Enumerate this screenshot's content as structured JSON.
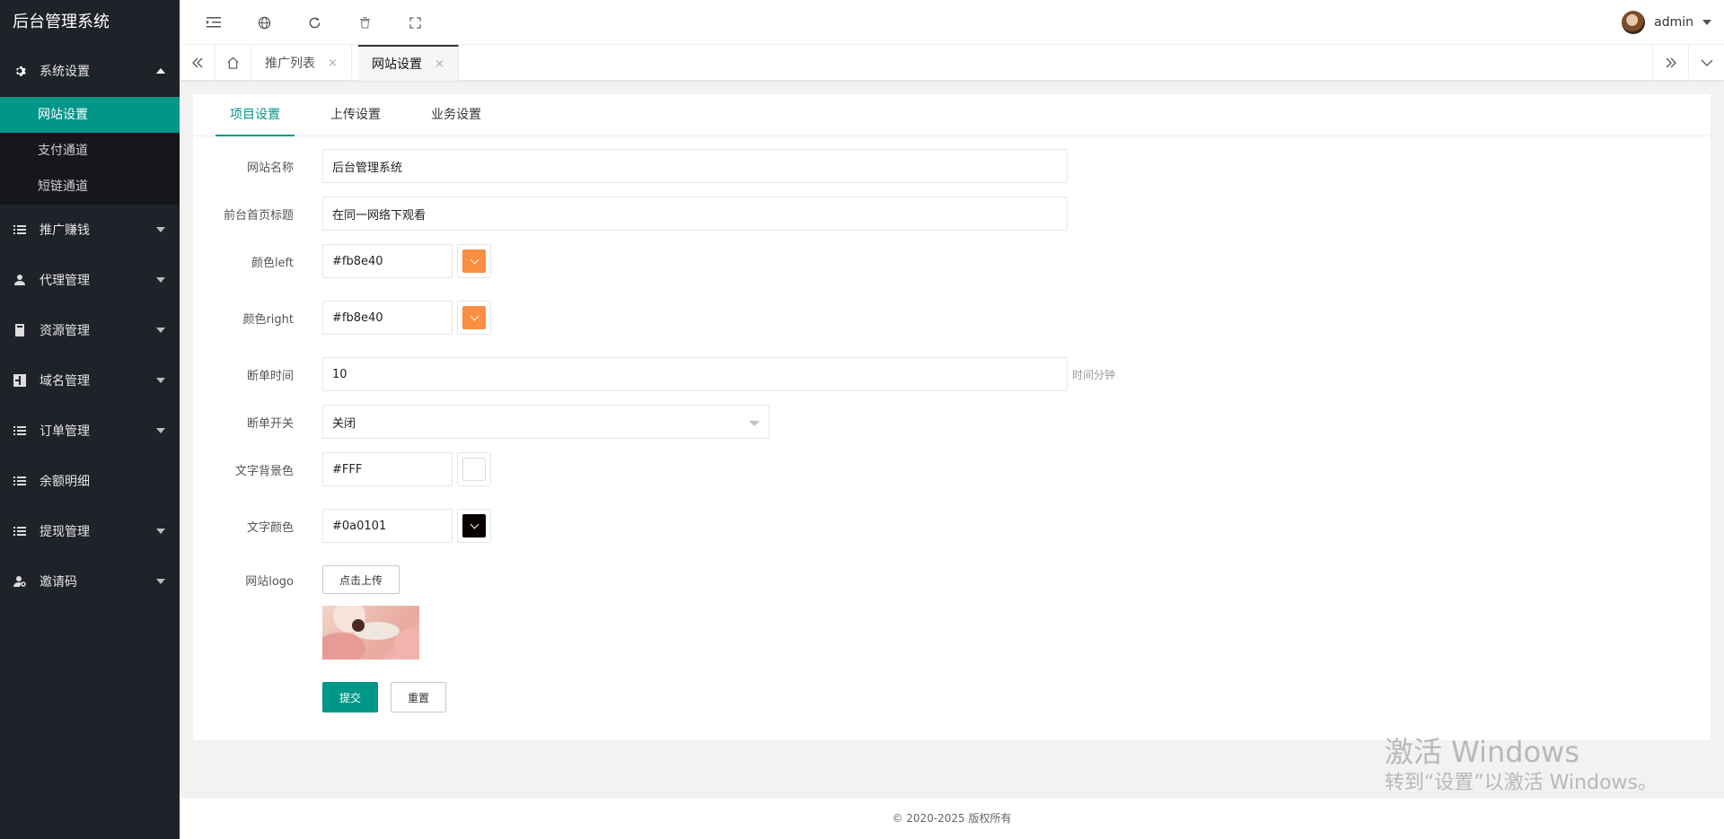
{
  "app": {
    "title": "后台管理系统"
  },
  "sidebar": {
    "groups": [
      {
        "label": "系统设置",
        "icon": "gear-icon",
        "expanded": true,
        "items": [
          {
            "label": "网站设置",
            "active": true
          },
          {
            "label": "支付通道"
          },
          {
            "label": "短链通道"
          }
        ]
      },
      {
        "label": "推广赚钱",
        "icon": "list-icon"
      },
      {
        "label": "代理管理",
        "icon": "users-icon"
      },
      {
        "label": "资源管理",
        "icon": "book-icon"
      },
      {
        "label": "域名管理",
        "icon": "grid-icon"
      },
      {
        "label": "订单管理",
        "icon": "list-icon"
      },
      {
        "label": "余额明细",
        "icon": "list-icon"
      },
      {
        "label": "提现管理",
        "icon": "list-icon"
      },
      {
        "label": "邀请码",
        "icon": "user-key-icon"
      }
    ]
  },
  "header": {
    "user_name": "admin"
  },
  "tabs": [
    {
      "label": "推广列表",
      "close": "×"
    },
    {
      "label": "网站设置",
      "close": "×",
      "active": true
    }
  ],
  "content_tabs": [
    "项目设置",
    "上传设置",
    "业务设置"
  ],
  "form": {
    "site_name": {
      "label": "网站名称",
      "value": "后台管理系统"
    },
    "home_title": {
      "label": "前台首页标题",
      "value": "在同一网络下观看"
    },
    "color_left": {
      "label": "颜色left",
      "value": "#fb8e40",
      "swatch": "#fb8e40"
    },
    "color_right": {
      "label": "颜色right",
      "value": "#fb8e40",
      "swatch": "#fb8e40"
    },
    "break_time": {
      "label": "断单时间",
      "value": "10",
      "aux": "时间分钟"
    },
    "break_switch": {
      "label": "断单开关",
      "value": "关闭"
    },
    "text_bg": {
      "label": "文字背景色",
      "value": "#FFF",
      "swatch": "#ffffff"
    },
    "text_color": {
      "label": "文字颜色",
      "value": "#0a0101",
      "swatch": "#0a0101"
    },
    "logo": {
      "label": "网站logo",
      "upload_label": "点击上传"
    },
    "submit_label": "提交",
    "reset_label": "重置"
  },
  "footer": {
    "text": "© 2020-2025 版权所有"
  },
  "watermark": {
    "line1": "激活 Windows",
    "line2": "转到“设置”以激活 Windows。"
  },
  "colors": {
    "accent": "#009688",
    "sidebar": "#20222a"
  }
}
